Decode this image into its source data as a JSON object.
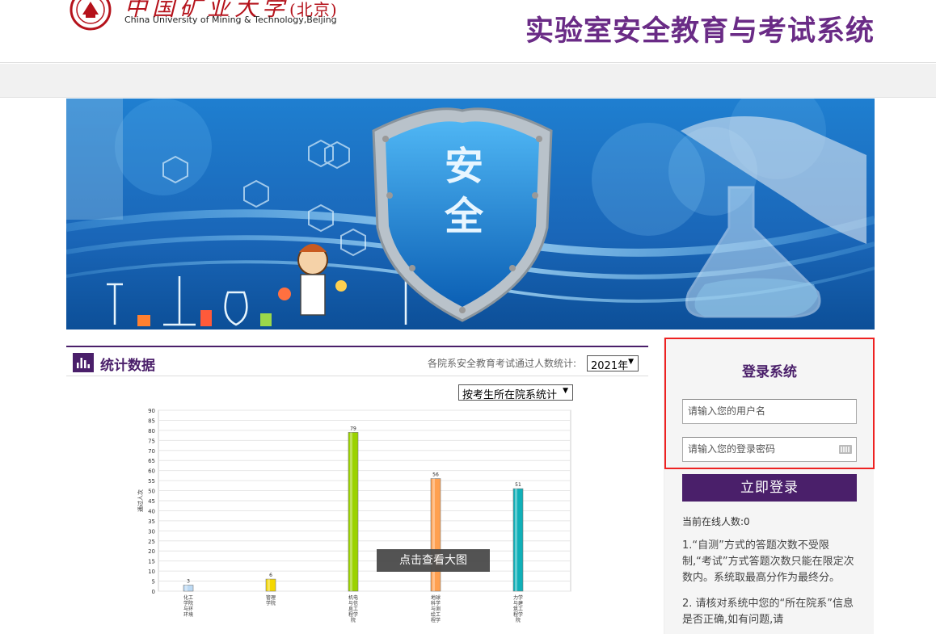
{
  "header": {
    "logo_cn": "中国矿业大学",
    "logo_cn_paren": "(北京)",
    "logo_en": "China University of Mining & Technology,Beijing",
    "site_title": "实验室安全教育与考试系统"
  },
  "banner": {
    "shield_char_1": "安",
    "shield_char_2": "全"
  },
  "stats": {
    "title": "统计数据",
    "label": "各院系安全教育考试通过人数统计:",
    "year_selected": "2021年",
    "mode_selected": "按考生所在院系统计",
    "overlay_button": "点击查看大图"
  },
  "chart_data": {
    "type": "bar",
    "ylabel": "通过人次",
    "ylim": [
      0,
      90
    ],
    "yticks": [
      0,
      5,
      10,
      15,
      20,
      25,
      30,
      35,
      40,
      45,
      50,
      55,
      60,
      65,
      70,
      75,
      80,
      85,
      90
    ],
    "categories": [
      "化工学院与环境",
      "管理学院",
      "机电与信息工程学院",
      "地球科学与测绘工程学院",
      "力学与建筑工程学院"
    ],
    "category_lines": [
      [
        "化工",
        "学院",
        "与环",
        "环境"
      ],
      [
        "管理",
        "学院"
      ],
      [
        "机电",
        "与信",
        "息工",
        "程学",
        "院"
      ],
      [
        "地球",
        "科学",
        "与测",
        "绘工",
        "程学"
      ],
      [
        "力学",
        "与建",
        "筑工",
        "程学",
        "院"
      ]
    ],
    "values": [
      3,
      6,
      79,
      56,
      51
    ],
    "colors": [
      "#bcd9f3",
      "#f5d800",
      "#9bd200",
      "#ffa050",
      "#10b0b8"
    ]
  },
  "login": {
    "title": "登录系统",
    "username_placeholder": "请输入您的用户名",
    "password_placeholder": "请输入您的登录密码",
    "submit": "立即登录",
    "online_label": "当前在线人数:",
    "online_count": "0",
    "note1": "1.“自测”方式的答题次数不受限制,“考试”方式答题次数只能在限定次数内。系统取最高分作为最终分。",
    "note2": "2. 请核对系统中您的“所在院系”信息是否正确,如有问题,请"
  },
  "colors": {
    "brand_purple": "#4a1f6a",
    "title_purple": "#6a2b86",
    "highlight_red": "#e22"
  }
}
